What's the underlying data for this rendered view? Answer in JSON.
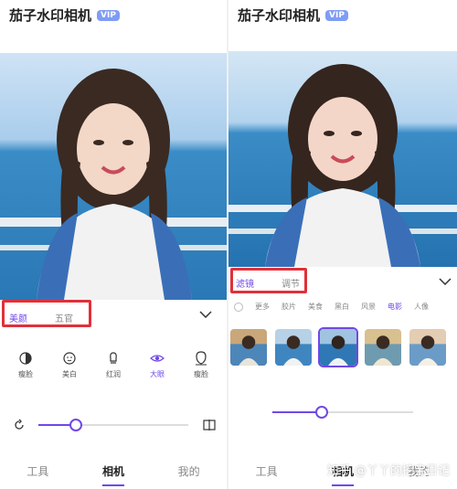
{
  "app": {
    "title": "茄子水印相机",
    "vip_badge": "VIP"
  },
  "left_panel": {
    "tabs": [
      {
        "label": "美颜",
        "active": true
      },
      {
        "label": "五官",
        "active": false
      }
    ],
    "tools": [
      {
        "label": "瘦脸",
        "icon": "contrast-icon",
        "active": false
      },
      {
        "label": "美白",
        "icon": "face-icon",
        "active": false
      },
      {
        "label": "红润",
        "icon": "bulb-icon",
        "active": false
      },
      {
        "label": "大眼",
        "icon": "eye-icon",
        "active": true
      },
      {
        "label": "瘦脸",
        "icon": "chin-icon",
        "active": false
      }
    ],
    "slider": {
      "value": 0.25
    },
    "nav": [
      {
        "label": "工具",
        "active": false
      },
      {
        "label": "相机",
        "active": true
      },
      {
        "label": "我的",
        "active": false
      }
    ]
  },
  "right_panel": {
    "tabs": [
      {
        "label": "滤镜",
        "active": true
      },
      {
        "label": "调节",
        "active": false
      }
    ],
    "filters": [
      {
        "label": "更多",
        "active": false
      },
      {
        "label": "胶片",
        "active": false
      },
      {
        "label": "美食",
        "active": false
      },
      {
        "label": "黑白",
        "active": false
      },
      {
        "label": "风景",
        "active": false
      },
      {
        "label": "电影",
        "active": true
      },
      {
        "label": "人像",
        "active": false
      }
    ],
    "thumbnails": 5,
    "selected_thumbnail": 2,
    "slider": {
      "value": 0.35
    },
    "nav": [
      {
        "label": "工具",
        "active": false
      },
      {
        "label": "相机",
        "active": true
      },
      {
        "label": "我的",
        "active": false
      }
    ]
  },
  "watermark": "知乎 @丫丫的挖宝日记",
  "colors": {
    "accent": "#7048e8",
    "highlight": "#e0303a",
    "vip": "#7f9cf5"
  }
}
